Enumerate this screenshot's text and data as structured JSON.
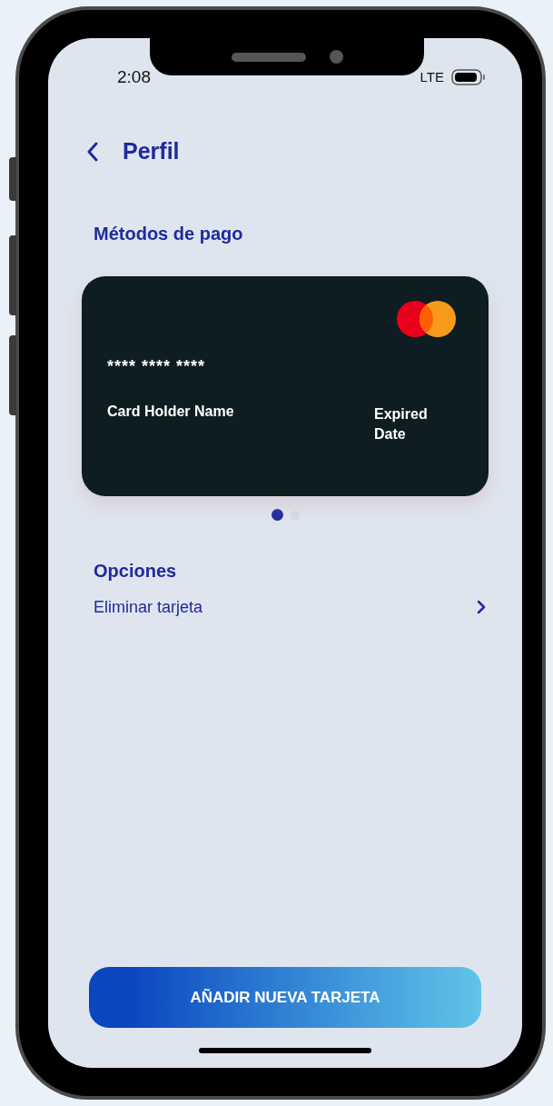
{
  "status_bar": {
    "time": "2:08",
    "network": "LTE"
  },
  "header": {
    "title": "Perfil"
  },
  "payment": {
    "title": "Métodos de pago",
    "card": {
      "number": "**** **** ****",
      "holder_label": "Card Holder Name",
      "expiry_label": "Expired Date"
    },
    "pager": [
      {
        "selected": true
      },
      {
        "selected": false
      }
    ]
  },
  "options": {
    "title": "Opciones",
    "items": [
      {
        "label": "Eliminar tarjeta"
      }
    ]
  },
  "primary_button": {
    "label": "AÑADIR NUEVA TARJETA"
  }
}
